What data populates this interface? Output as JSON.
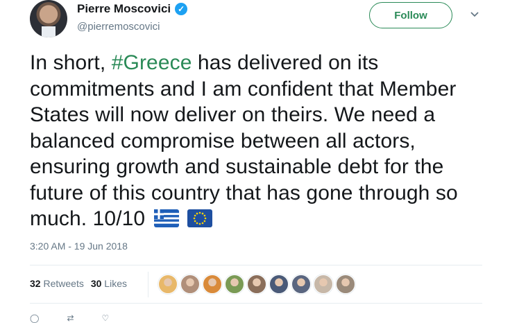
{
  "author": {
    "name": "Pierre Moscovici",
    "handle": "@pierremoscovici",
    "verified_icon": "verified-badge-icon",
    "avatar_icon": "profile-avatar"
  },
  "header": {
    "follow_label": "Follow",
    "more_icon": "chevron-down-icon"
  },
  "tweet": {
    "text_before": "In short, ",
    "hashtag": "#Greece",
    "text_after": " has delivered on its commitments and I am confident that Member States will now deliver on theirs. We need a balanced compromise between all actors, ensuring growth and sustainable debt for the future of this country that has gone through so much. 10/10",
    "emoji": [
      "flag-greece-icon",
      "flag-eu-icon"
    ],
    "timestamp": "3:20 AM - 19 Jun 2018"
  },
  "stats": {
    "retweets_count": "32",
    "retweets_label": "Retweets",
    "likes_count": "30",
    "likes_label": "Likes"
  },
  "likers": [
    {
      "icon": "liker-avatar-1",
      "color": "#e8b86a"
    },
    {
      "icon": "liker-avatar-2",
      "color": "#b08f7a"
    },
    {
      "icon": "liker-avatar-3",
      "color": "#d98a3a"
    },
    {
      "icon": "liker-avatar-4",
      "color": "#7a9a55"
    },
    {
      "icon": "liker-avatar-5",
      "color": "#8a6e5a"
    },
    {
      "icon": "liker-avatar-6",
      "color": "#4a5a78"
    },
    {
      "icon": "liker-avatar-7",
      "color": "#5a6680"
    },
    {
      "icon": "liker-avatar-8",
      "color": "#c7b8a8"
    },
    {
      "icon": "liker-avatar-9",
      "color": "#9a8a7a"
    }
  ],
  "colors": {
    "accent": "#2a8a57",
    "text": "#14171a",
    "muted": "#657786",
    "divider": "#e6ecf0"
  }
}
